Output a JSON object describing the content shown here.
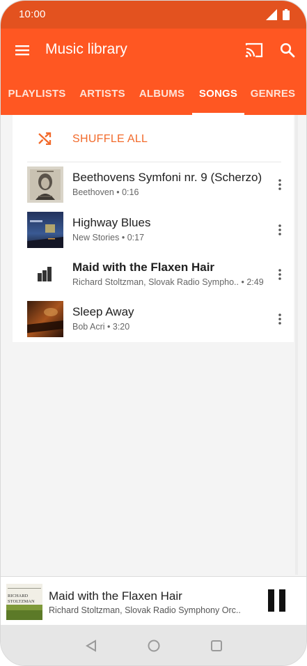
{
  "status_bar": {
    "time": "10:00"
  },
  "app_bar": {
    "title": "Music library"
  },
  "tabs": [
    {
      "label": "PLAYLISTS"
    },
    {
      "label": "ARTISTS"
    },
    {
      "label": "ALBUMS"
    },
    {
      "label": "SONGS",
      "active": true
    },
    {
      "label": "GENRES"
    }
  ],
  "shuffle": {
    "label": "SHUFFLE ALL"
  },
  "songs": [
    {
      "title": "Beethovens Symfoni nr. 9 (Scherzo)",
      "subtitle": "Beethoven • 0:16",
      "art": "beethoven-portrait"
    },
    {
      "title": "Highway Blues",
      "subtitle": "New Stories • 0:17",
      "art": "highway-night"
    },
    {
      "title": "Maid with the Flaxen Hair",
      "subtitle": "Richard Stoltzman, Slovak Radio Sympho.. • 2:49",
      "art": "now-playing-equalizer",
      "playing": true
    },
    {
      "title": "Sleep Away",
      "subtitle": "Bob Acri • 3:20",
      "art": "piano-warm"
    }
  ],
  "now_playing": {
    "title": "Maid with the Flaxen Hair",
    "subtitle": "Richard Stoltzman, Slovak Radio Symphony Orc..",
    "art_text": "RICHARD STOLTZMAN"
  },
  "colors": {
    "accent": "#ff5722",
    "status_bar": "#e3521f",
    "shuffle": "#f26a2b"
  }
}
